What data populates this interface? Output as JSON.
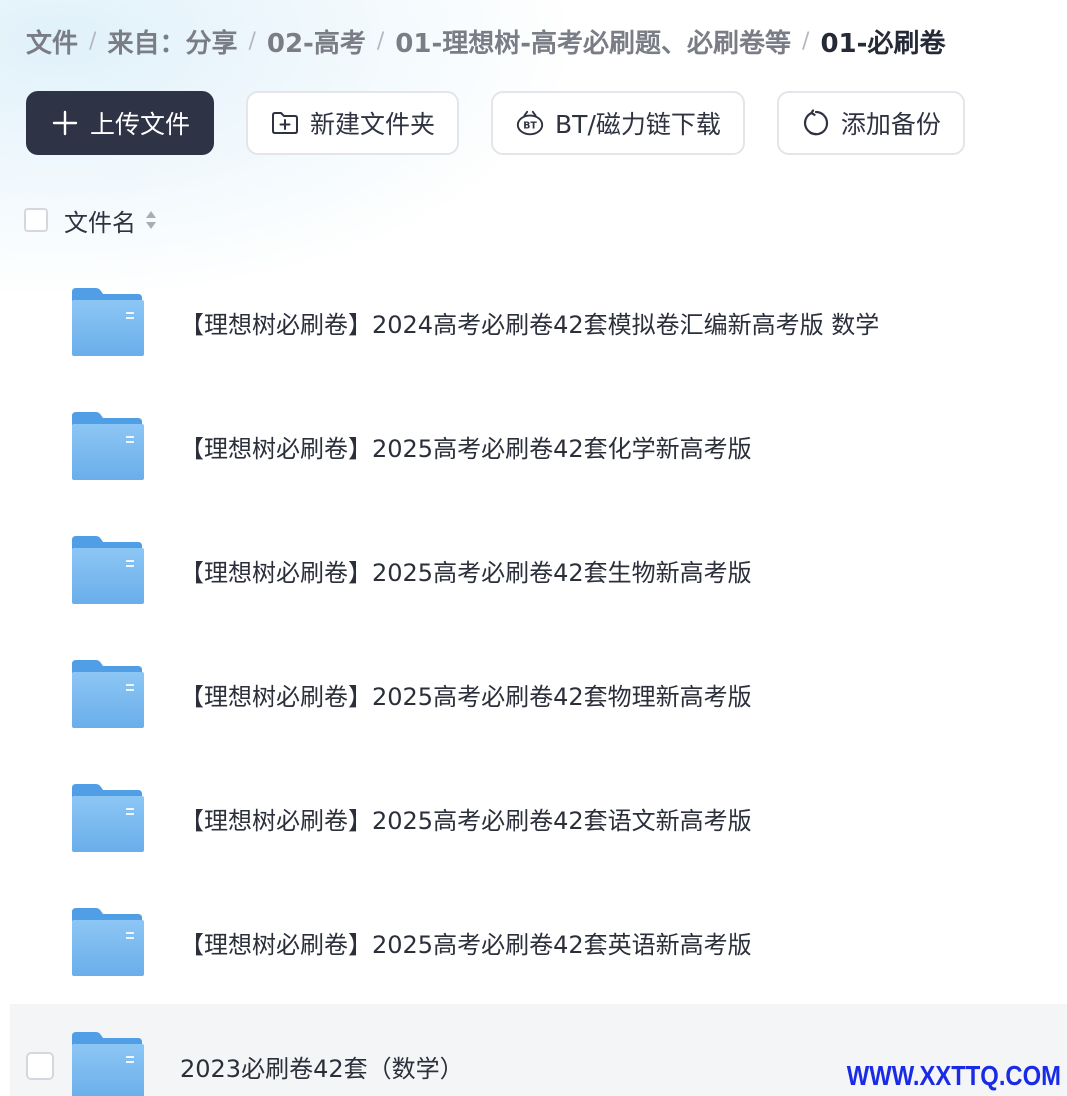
{
  "breadcrumb": {
    "items": [
      "文件",
      "来自：分享",
      "02-高考",
      "01-理想树-高考必刷题、必刷卷等"
    ],
    "current": "01-必刷卷",
    "separator": "/"
  },
  "toolbar": {
    "upload_label": "上传文件",
    "upload_icon": "plus-icon",
    "new_folder_label": "新建文件夹",
    "new_folder_icon": "folder-plus-icon",
    "bt_label": "BT/磁力链下载",
    "bt_icon": "bt-icon",
    "backup_label": "添加备份",
    "backup_icon": "sync-icon",
    "primary_color": "#2e3346"
  },
  "list": {
    "header_label": "文件名",
    "sort_icon": "sort-icon",
    "rows": [
      {
        "name": "【理想树必刷卷】2024高考必刷卷42套模拟卷汇编新高考版 数学",
        "type": "folder"
      },
      {
        "name": "【理想树必刷卷】2025高考必刷卷42套化学新高考版",
        "type": "folder"
      },
      {
        "name": "【理想树必刷卷】2025高考必刷卷42套生物新高考版",
        "type": "folder"
      },
      {
        "name": "【理想树必刷卷】2025高考必刷卷42套物理新高考版",
        "type": "folder"
      },
      {
        "name": "【理想树必刷卷】2025高考必刷卷42套语文新高考版",
        "type": "folder"
      },
      {
        "name": "【理想树必刷卷】2025高考必刷卷42套英语新高考版",
        "type": "folder"
      },
      {
        "name": "2023必刷卷42套（数学）",
        "type": "folder",
        "hovered": true
      }
    ]
  },
  "folder_color": "#6fb4ef",
  "watermark": "WWW.XXTTQ.COM"
}
